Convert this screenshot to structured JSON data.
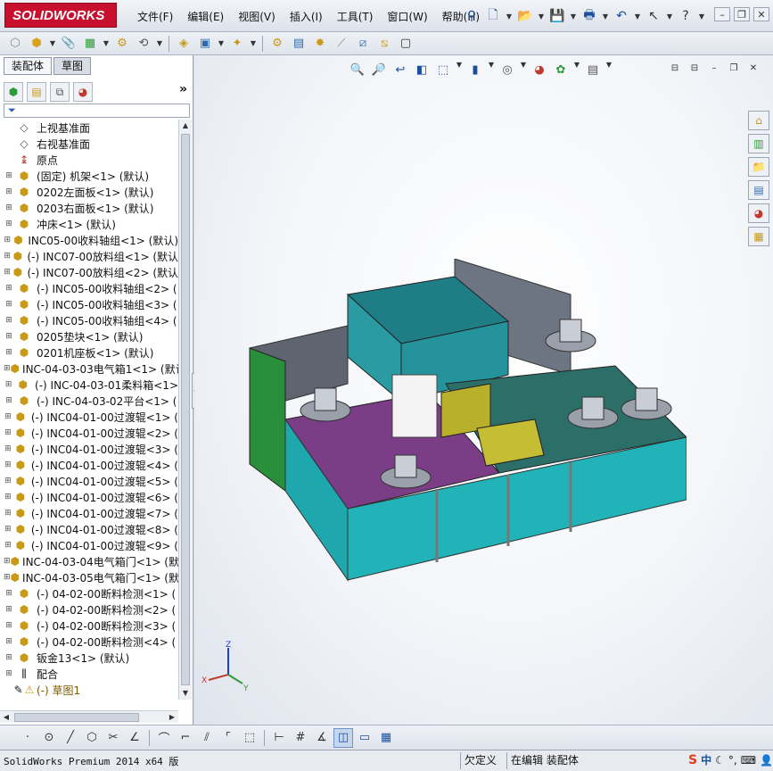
{
  "app": {
    "logo_text": "SOLIDWORKS",
    "menu": [
      "文件(F)",
      "编辑(E)",
      "视图(V)",
      "插入(I)",
      "工具(T)",
      "窗口(W)",
      "帮助(H)"
    ]
  },
  "panel": {
    "tabs": [
      "装配体",
      "草图"
    ],
    "more_label": "»",
    "filter_icon": "filter-icon",
    "tree": [
      {
        "label": "上视基准面",
        "icon": "plane",
        "toggle": ""
      },
      {
        "label": "右视基准面",
        "icon": "plane",
        "toggle": ""
      },
      {
        "label": "原点",
        "icon": "origin",
        "toggle": ""
      },
      {
        "label": "(固定) 机架<1> (默认)",
        "icon": "asm",
        "toggle": "+"
      },
      {
        "label": "0202左面板<1> (默认)",
        "icon": "asm",
        "toggle": "+"
      },
      {
        "label": "0203右面板<1> (默认)",
        "icon": "asm",
        "toggle": "+"
      },
      {
        "label": "冲床<1> (默认)",
        "icon": "asm",
        "toggle": "+"
      },
      {
        "label": "INC05-00收料轴组<1> (默认)",
        "icon": "asm",
        "toggle": "+"
      },
      {
        "label": "(-) INC07-00放料组<1> (默认",
        "icon": "asm",
        "toggle": "+"
      },
      {
        "label": "(-) INC07-00放料组<2> (默认",
        "icon": "asm",
        "toggle": "+"
      },
      {
        "label": "(-) INC05-00收料轴组<2> (",
        "icon": "asm",
        "toggle": "+"
      },
      {
        "label": "(-) INC05-00收料轴组<3> (",
        "icon": "asm",
        "toggle": "+"
      },
      {
        "label": "(-) INC05-00收料轴组<4> (",
        "icon": "asm",
        "toggle": "+"
      },
      {
        "label": "0205垫块<1> (默认)",
        "icon": "asm",
        "toggle": "+"
      },
      {
        "label": "0201机座板<1> (默认)",
        "icon": "asm",
        "toggle": "+"
      },
      {
        "label": "INC-04-03-03电气箱1<1> (默认",
        "icon": "asm",
        "toggle": "+"
      },
      {
        "label": "(-) INC-04-03-01柔料箱<1>",
        "icon": "asm",
        "toggle": "+"
      },
      {
        "label": "(-) INC-04-03-02平台<1> (",
        "icon": "asm",
        "toggle": "+"
      },
      {
        "label": "(-) INC04-01-00过渡辊<1> (",
        "icon": "asm",
        "toggle": "+"
      },
      {
        "label": "(-) INC04-01-00过渡辊<2> (",
        "icon": "asm",
        "toggle": "+"
      },
      {
        "label": "(-) INC04-01-00过渡辊<3> (",
        "icon": "asm",
        "toggle": "+"
      },
      {
        "label": "(-) INC04-01-00过渡辊<4> (",
        "icon": "asm",
        "toggle": "+"
      },
      {
        "label": "(-) INC04-01-00过渡辊<5> (",
        "icon": "asm",
        "toggle": "+"
      },
      {
        "label": "(-) INC04-01-00过渡辊<6> (",
        "icon": "asm",
        "toggle": "+"
      },
      {
        "label": "(-) INC04-01-00过渡辊<7> (",
        "icon": "asm",
        "toggle": "+"
      },
      {
        "label": "(-) INC04-01-00过渡辊<8> (",
        "icon": "asm",
        "toggle": "+"
      },
      {
        "label": "(-) INC04-01-00过渡辊<9> (",
        "icon": "asm",
        "toggle": "+"
      },
      {
        "label": "INC-04-03-04电气箱门<1> (默",
        "icon": "asm",
        "toggle": "+"
      },
      {
        "label": "INC-04-03-05电气箱门<1> (默",
        "icon": "asm",
        "toggle": "+"
      },
      {
        "label": "(-) 04-02-00断料检测<1> (",
        "icon": "asm",
        "toggle": "+"
      },
      {
        "label": "(-) 04-02-00断料检测<2> (",
        "icon": "asm",
        "toggle": "+"
      },
      {
        "label": "(-) 04-02-00断料检测<3> (",
        "icon": "asm",
        "toggle": "+"
      },
      {
        "label": "(-) 04-02-00断料检测<4> (",
        "icon": "asm",
        "toggle": "+"
      },
      {
        "label": "钣金13<1> (默认)",
        "icon": "asm",
        "toggle": "+"
      },
      {
        "label": "配合",
        "icon": "mate",
        "toggle": "+"
      },
      {
        "label": "(-) 草图1",
        "icon": "sketch",
        "toggle": ""
      }
    ]
  },
  "viewport": {
    "triad_labels": {
      "z": "Z",
      "x": "X",
      "y": "Y"
    }
  },
  "status": {
    "version": "SolidWorks Premium 2014 x64 版",
    "underdefined": "欠定义",
    "editing": "在编辑 装配体",
    "ime_s": "S",
    "ime_zh": "中"
  }
}
